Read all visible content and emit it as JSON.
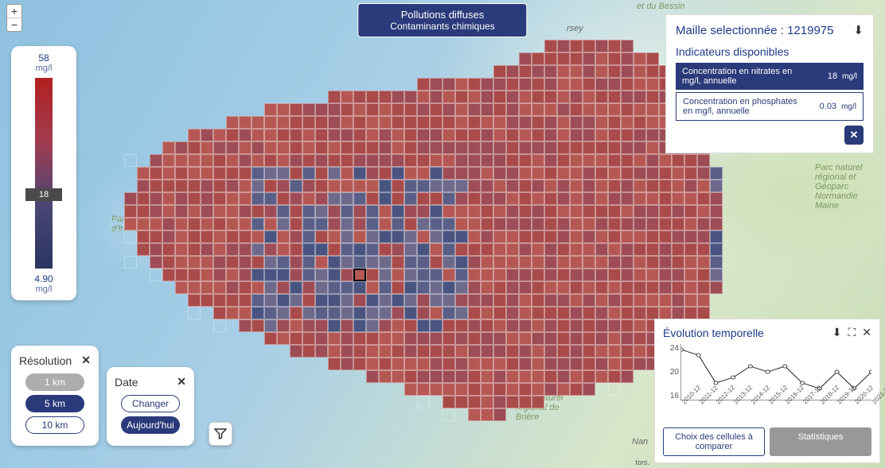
{
  "title": {
    "line1": "Pollutions diffuses",
    "line2": "Contaminants chimiques"
  },
  "zoom": {
    "in": "+",
    "out": "−"
  },
  "legend": {
    "max": "58",
    "max_unit": "mg/l",
    "min": "4.90",
    "min_unit": "mg/l",
    "marker": "18"
  },
  "map_labels": {
    "iroise": "Parc naturel\nmarin d'Iroise",
    "briere": "Parc naturel régional de Brière",
    "normandie": "Parc naturel régional et Géoparc Normandie Maine",
    "bessin": "et du Bessin",
    "jersey": "rsey",
    "nantes": "Nan"
  },
  "resolution": {
    "title": "Résolution",
    "options": [
      "1 km",
      "5 km",
      "10 km"
    ],
    "active_index": 1,
    "disabled_index": 0
  },
  "date": {
    "title": "Date",
    "changer": "Changer",
    "today": "Aujourd'hui"
  },
  "maille": {
    "label": "Maille selectionnée :",
    "id": "1219975",
    "indicators_title": "Indicateurs disponibles",
    "rows": [
      {
        "label": "Concentration en nitrates en mg/l, annuelle",
        "value": "18",
        "unit": "mg/l",
        "active": true
      },
      {
        "label": "Concentration en phosphates en mg/l, annuelle",
        "value": "0.03",
        "unit": "mg/l",
        "active": false
      }
    ]
  },
  "temporal": {
    "title": "Évolution temporelle",
    "compare": "Choix des cellules à comparer",
    "stats": "Statistiques"
  },
  "chart_data": {
    "type": "line",
    "x": [
      "2010-12",
      "2011-12",
      "2012-12",
      "2013-12",
      "2014-12",
      "2015-12",
      "2016-12",
      "2017-12",
      "2018-12",
      "2019-12",
      "2020-12",
      "2021-12"
    ],
    "y": [
      23,
      22,
      17,
      18,
      20,
      19,
      20,
      17,
      16,
      19,
      16,
      19
    ],
    "ylim": [
      14,
      24
    ],
    "y_ticks": [
      16,
      20,
      24
    ],
    "xlabel": "",
    "ylabel": "",
    "title": ""
  },
  "attribution": "tors."
}
